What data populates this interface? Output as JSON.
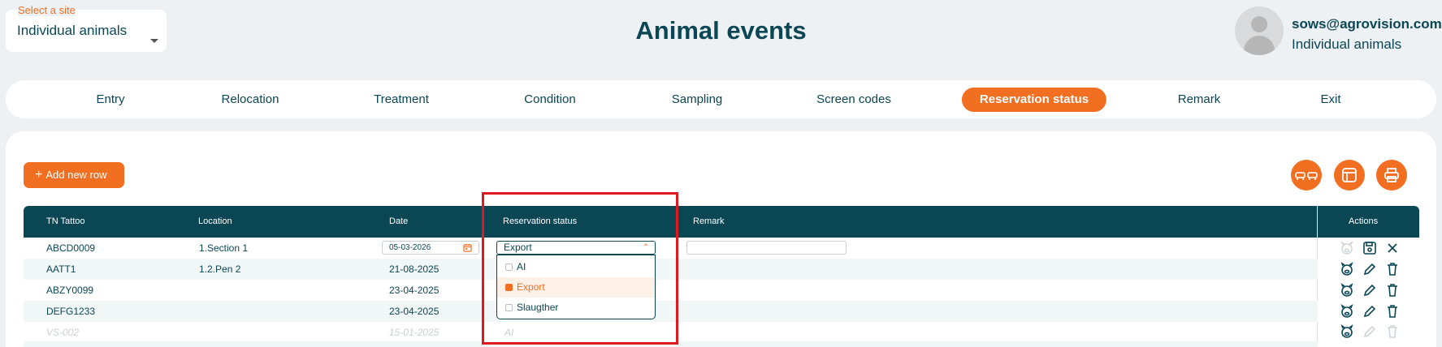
{
  "site": {
    "label": "Select a site",
    "value": "Individual animals"
  },
  "page_title": "Animal events",
  "user": {
    "email": "sows@agrovision.com",
    "site": "Individual animals"
  },
  "nav": {
    "items": [
      {
        "label": "Entry"
      },
      {
        "label": "Relocation"
      },
      {
        "label": "Treatment"
      },
      {
        "label": "Condition"
      },
      {
        "label": "Sampling"
      },
      {
        "label": "Screen codes"
      },
      {
        "label": "Reservation status",
        "active": true
      },
      {
        "label": "Remark"
      },
      {
        "label": "Exit"
      }
    ]
  },
  "toolbar": {
    "add_label": "Add new row",
    "plus": "+",
    "buttons": [
      "pigs-icon",
      "columns-icon",
      "print-icon"
    ]
  },
  "table": {
    "headers": {
      "tattoo": "TN Tattoo",
      "location": "Location",
      "date": "Date",
      "reservation": "Reservation status",
      "remark": "Remark",
      "actions": "Actions"
    },
    "editing_row": {
      "tattoo": "ABCD0009",
      "location": "1.Section 1",
      "date": "05-03-2026",
      "reservation": "Export",
      "remark": ""
    },
    "rows": [
      {
        "tattoo": "AATT1",
        "location": "1.2.Pen 2",
        "date": "21-08-2025",
        "reservation": ""
      },
      {
        "tattoo": "ABZY0099",
        "location": "",
        "date": "23-04-2025",
        "reservation": ""
      },
      {
        "tattoo": "DEFG1233",
        "location": "",
        "date": "23-04-2025",
        "reservation": ""
      },
      {
        "tattoo": "VS-002",
        "location": "",
        "date": "15-01-2025",
        "reservation": "AI",
        "faded": true
      }
    ]
  },
  "dropdown": {
    "options": [
      {
        "label": "AI",
        "selected": false
      },
      {
        "label": "Export",
        "selected": true
      },
      {
        "label": "Slaugther",
        "selected": false
      }
    ]
  },
  "colors": {
    "accent": "#f26f21",
    "primary": "#0b4654",
    "highlight": "#e0181f",
    "background": "#edf1f4"
  }
}
